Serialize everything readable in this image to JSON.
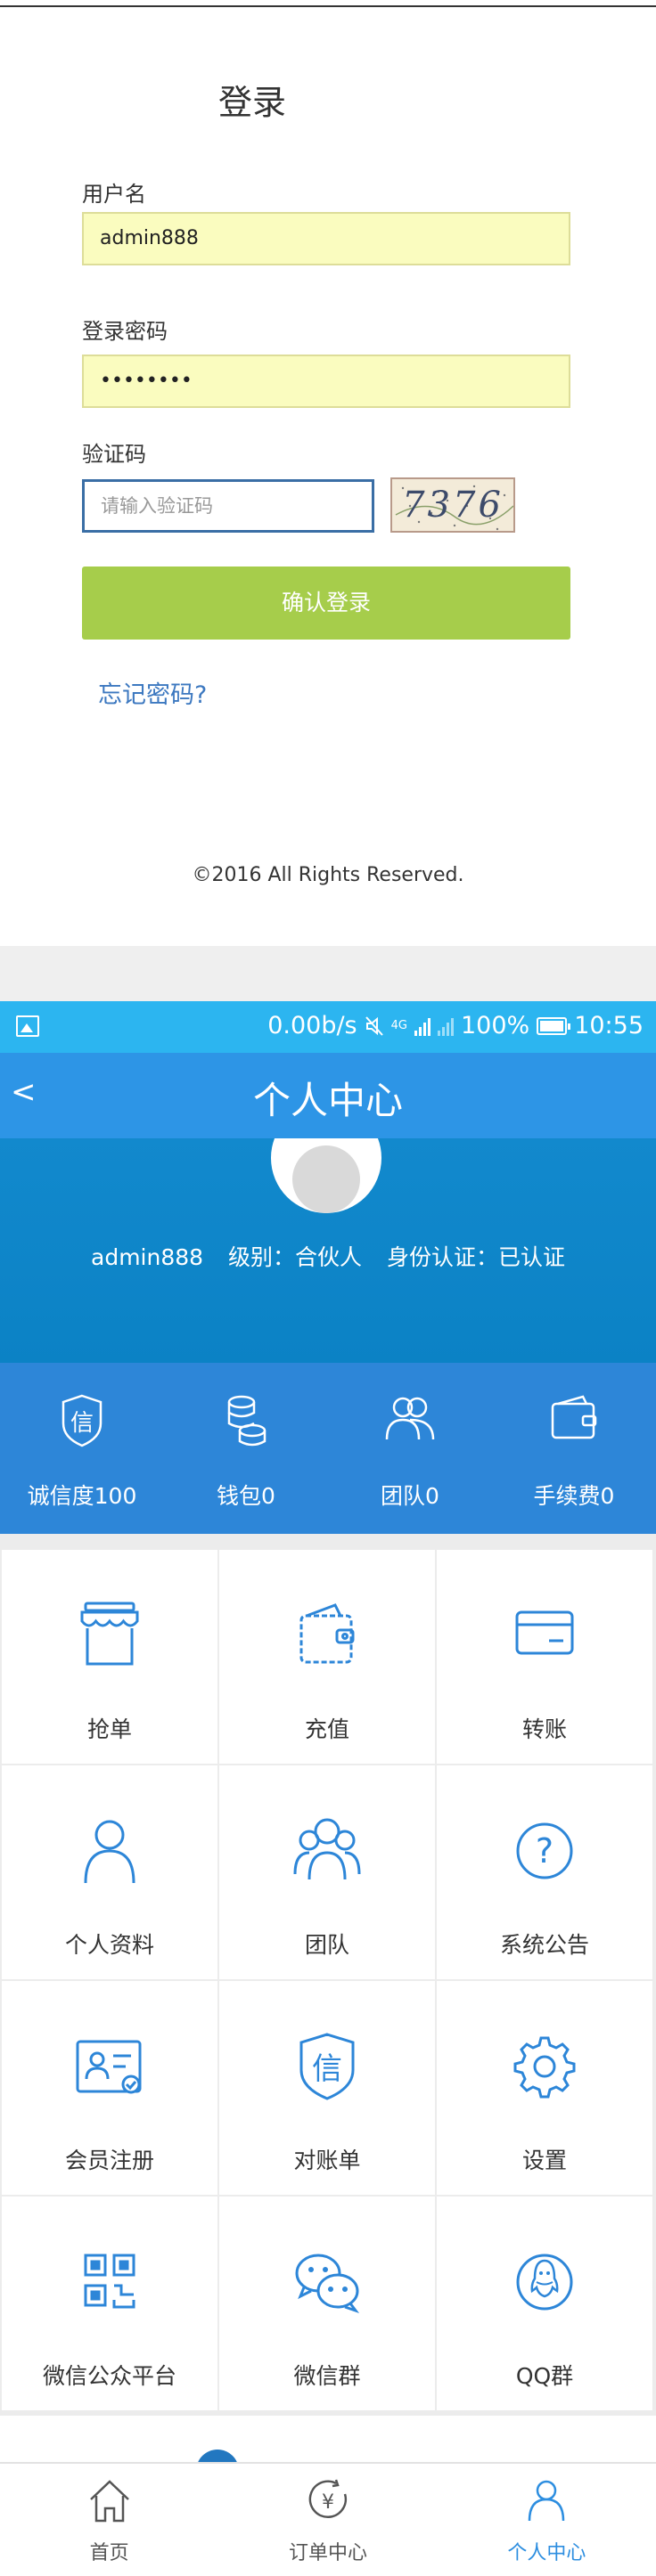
{
  "login": {
    "title": "登录",
    "username_label": "用户名",
    "username_value": "admin888",
    "password_label": "登录密码",
    "password_value": "••••••••",
    "captcha_label": "验证码",
    "captcha_placeholder": "请输入验证码",
    "captcha_text": "7376",
    "submit_label": "确认登录",
    "forgot_label": "忘记密码?",
    "copyright": "©2016 All Rights Reserved."
  },
  "status_bar": {
    "speed": "0.00b/s",
    "network": "4G",
    "battery": "100%",
    "time": "10:55"
  },
  "header": {
    "back_symbol": "<",
    "title": "个人中心"
  },
  "profile": {
    "username": "admin888",
    "level": "级别：合伙人",
    "verification": "身份认证：已认证"
  },
  "stats": [
    {
      "label": "诚信度100",
      "icon": "shield-xin-icon"
    },
    {
      "label": "钱包0",
      "icon": "coins-icon"
    },
    {
      "label": "团队0",
      "icon": "team-icon"
    },
    {
      "label": "手续费0",
      "icon": "wallet-icon"
    }
  ],
  "menu": [
    {
      "label": "抢单",
      "icon": "store-icon"
    },
    {
      "label": "充值",
      "icon": "wallet-icon"
    },
    {
      "label": "转账",
      "icon": "card-icon"
    },
    {
      "label": "个人资料",
      "icon": "person-icon"
    },
    {
      "label": "团队",
      "icon": "team-icon"
    },
    {
      "label": "系统公告",
      "icon": "question-icon"
    },
    {
      "label": "会员注册",
      "icon": "id-card-icon"
    },
    {
      "label": "对账单",
      "icon": "shield-xin-icon"
    },
    {
      "label": "设置",
      "icon": "gear-icon"
    },
    {
      "label": "微信公众平台",
      "icon": "qr-code-icon"
    },
    {
      "label": "微信群",
      "icon": "wechat-icon"
    },
    {
      "label": "QQ群",
      "icon": "qq-icon"
    }
  ],
  "tabbar": [
    {
      "label": "首页",
      "icon": "home-icon"
    },
    {
      "label": "订单中心",
      "icon": "yen-icon"
    },
    {
      "label": "个人中心",
      "icon": "person-icon",
      "active": true
    }
  ],
  "colors": {
    "accent_blue": "#2d95e6",
    "status_bar": "#2cb5f0",
    "profile_band": "#0b82c5",
    "login_button": "#a6cd4b",
    "icon_blue": "#2d86d8"
  }
}
